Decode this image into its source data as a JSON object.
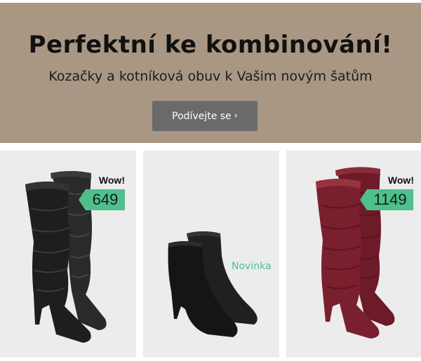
{
  "banner": {
    "title": "Perfektní ke kombinování!",
    "subtitle": "Kozačky a kotníková obuv k Vašim novým šatům",
    "cta_label": "Podívejte se",
    "cta_chevron": "›",
    "background_color": "#a99784"
  },
  "products": [
    {
      "badge": "Wow!",
      "price": "649",
      "boot_color": "#1e1e1e",
      "type": "knee-high-slouch-boots"
    },
    {
      "label": "Novinka",
      "boot_color": "#1a1a1a",
      "type": "ankle-boots"
    },
    {
      "badge": "Wow!",
      "price": "1149",
      "boot_color": "#7a1f2e",
      "type": "knee-high-slouch-boots"
    }
  ],
  "colors": {
    "price_tag": "#4fbf8c",
    "card_bg": "#ececec",
    "cta_bg": "#6a6a6a"
  }
}
